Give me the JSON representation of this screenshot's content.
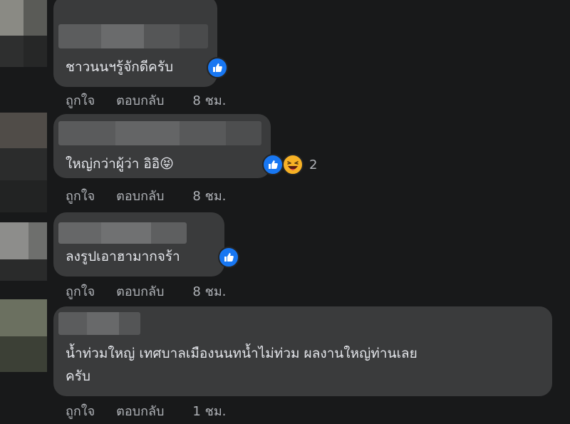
{
  "comments": [
    {
      "text": "ชาวนนฯรู้จักดีครับ",
      "like_label": "ถูกใจ",
      "reply_label": "ตอบกลับ",
      "time": "8 ชม.",
      "reactions": [
        "like"
      ],
      "reaction_count": ""
    },
    {
      "text": "ใหญ่กว่าผู้ว่า อิอิ😝",
      "like_label": "ถูกใจ",
      "reply_label": "ตอบกลับ",
      "time": "8 ชม.",
      "reactions": [
        "like",
        "haha"
      ],
      "reaction_count": "2"
    },
    {
      "text": "ลงรูปเอาฮามากจร้า",
      "like_label": "ถูกใจ",
      "reply_label": "ตอบกลับ",
      "time": "8 ชม.",
      "reactions": [
        "like"
      ],
      "reaction_count": ""
    },
    {
      "text_line1": "น้ำท่วมใหญ่ เทศบาลเมืองนนทน้ำไม่ท่วม ผลงานใหญ่ท่านเลย",
      "text_line2": "ครับ",
      "like_label": "ถูกใจ",
      "reply_label": "ตอบกลับ",
      "time": "1 ชม.",
      "reactions": [],
      "reaction_count": ""
    }
  ],
  "colors": {
    "background": "#18191a",
    "bubble": "#3a3b3c",
    "text": "#e4e6eb",
    "secondary": "#b0b3b8",
    "like": "#1877f2",
    "haha": "#f7b125"
  }
}
